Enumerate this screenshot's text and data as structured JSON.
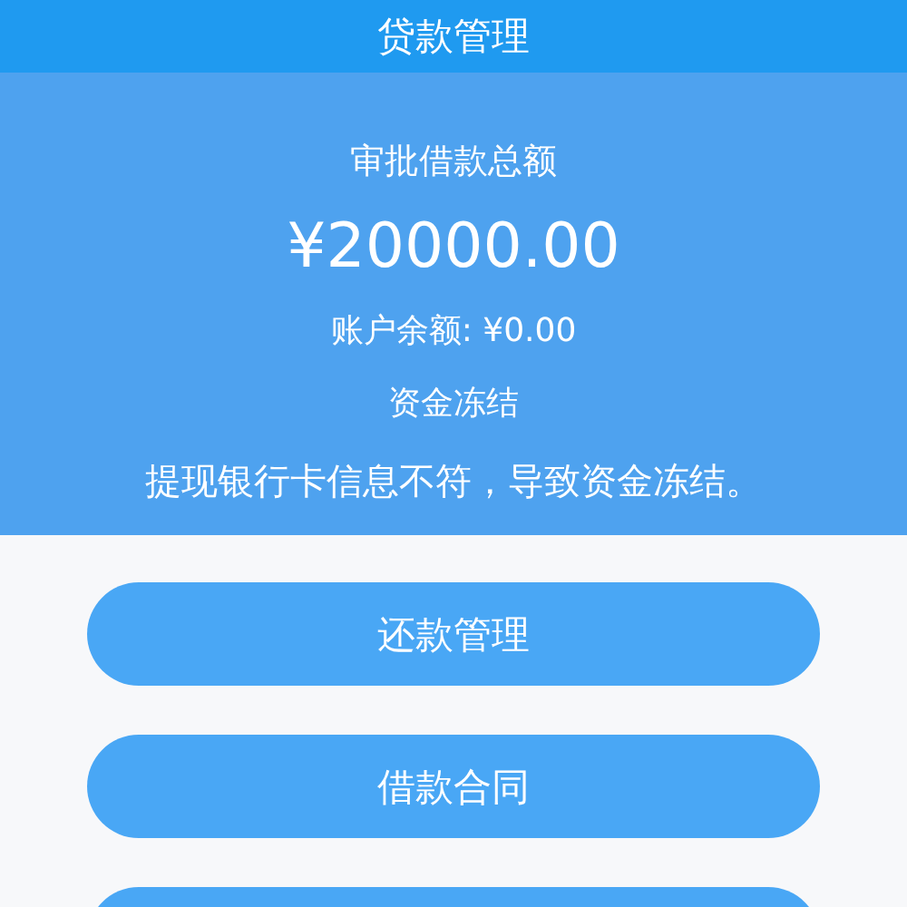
{
  "header": {
    "title": "贷款管理"
  },
  "summary": {
    "label": "审批借款总额",
    "amount": "¥20000.00",
    "balance": "账户余额: ¥0.00",
    "status": "资金冻结",
    "message": "提现银行卡信息不符，导致资金冻结。"
  },
  "buttons": [
    {
      "label": "还款管理"
    },
    {
      "label": "借款合同"
    }
  ]
}
